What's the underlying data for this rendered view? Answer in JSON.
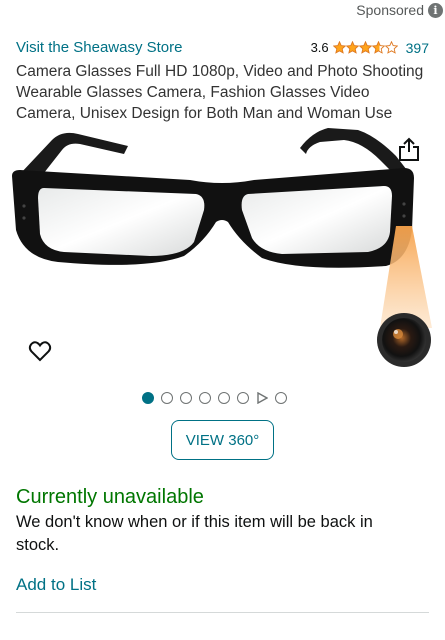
{
  "sponsored": {
    "label": "Sponsored",
    "icon": "info-icon"
  },
  "store": {
    "link_text": "Visit the Sheawasy Store"
  },
  "rating": {
    "value": "3.6",
    "stars": 3.6,
    "count": "397"
  },
  "product": {
    "title": "Camera Glasses Full HD 1080p, Video and Photo Shooting Wearable Glasses Camera, Fashion Glasses Video Camera, Unisex Design for Both Man and Woman Use"
  },
  "gallery": {
    "total_items": 8,
    "active_index": 0,
    "video_index": 6
  },
  "buttons": {
    "view360_label": "VIEW 360°"
  },
  "availability": {
    "status": "Currently unavailable",
    "note": "We don't know when or if this item will be back in stock."
  },
  "actions": {
    "add_to_list": "Add to List"
  },
  "colors": {
    "link": "#007185",
    "availability": "#007600",
    "star": "#ffa41c"
  }
}
